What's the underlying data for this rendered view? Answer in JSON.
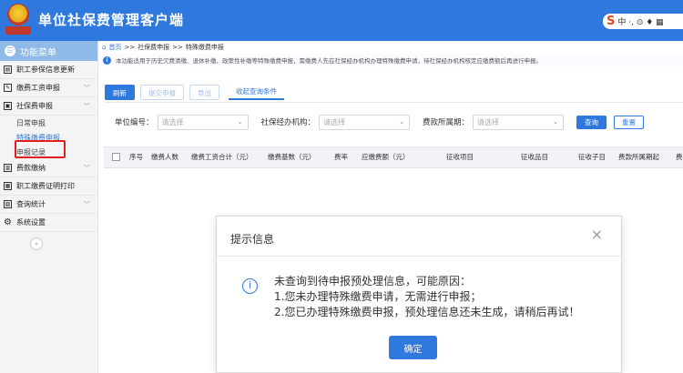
{
  "app": {
    "title": "单位社保费管理客户端"
  },
  "header_tools": {
    "brand_glyph": "S",
    "label": "中 ·, ⊙ ♦ ▦"
  },
  "sidebar": {
    "header": "功能菜单",
    "items": [
      {
        "label": "职工参保信息更新",
        "icon": "person-card-icon"
      },
      {
        "label": "缴费工资申报",
        "icon": "edit-icon",
        "expandable": true
      },
      {
        "label": "社保费申报",
        "icon": "document-icon",
        "expandable": true,
        "expanded": true
      },
      {
        "label": "费款缴纳",
        "icon": "wallet-icon",
        "expandable": true
      },
      {
        "label": "职工缴费证明打印",
        "icon": "printer-icon"
      },
      {
        "label": "查询统计",
        "icon": "chart-icon",
        "expandable": true
      },
      {
        "label": "系统设置",
        "icon": "gear-icon"
      }
    ],
    "subitems": [
      {
        "label": "日常申报",
        "active": false
      },
      {
        "label": "特殊缴费申报",
        "active": true
      },
      {
        "label": "申报记录",
        "active": false
      }
    ],
    "collapse_glyph": "«"
  },
  "breadcrumb": {
    "home": "首页",
    "sep": ">>",
    "level1": "社保费申报",
    "level2": "特殊缴费申报"
  },
  "notice": {
    "text": "本功能适用于历史欠费清缴、退休补缴、政策性补缴等特殊缴费申报，需缴费人先在社保经办机构办理特殊缴费申请，待社保经办机构核定应缴费额后再进行申报。"
  },
  "toolbar": {
    "refresh": "刷新",
    "submit": "提交申报",
    "export": "导出",
    "collapse_filters": "收起查询条件"
  },
  "filters": {
    "unit_code": {
      "label": "单位编号：",
      "placeholder": "请选择"
    },
    "agency": {
      "label": "社保经办机构：",
      "placeholder": "请选择"
    },
    "period": {
      "label": "费款所属期：",
      "placeholder": "请选择"
    },
    "query": "查询",
    "reset": "重置"
  },
  "table": {
    "columns": [
      "序号",
      "缴费人数",
      "缴费工资合计（元）",
      "缴费基数（元）",
      "费率",
      "应缴费额（元）",
      "征收项目",
      "征收品目",
      "征收子目",
      "费款所属期起",
      "费"
    ]
  },
  "modal": {
    "title": "提示信息",
    "close": "×",
    "lines": [
      "未查询到待申报预处理信息，可能原因：",
      "1.您未办理特殊缴费申请，无需进行申报；",
      "2.您已办理特殊缴费申报，预处理信息还未生成，请稍后再试！"
    ],
    "ok": "确定"
  },
  "colors": {
    "primary": "#2f78dd",
    "highlight": "#e02020"
  }
}
